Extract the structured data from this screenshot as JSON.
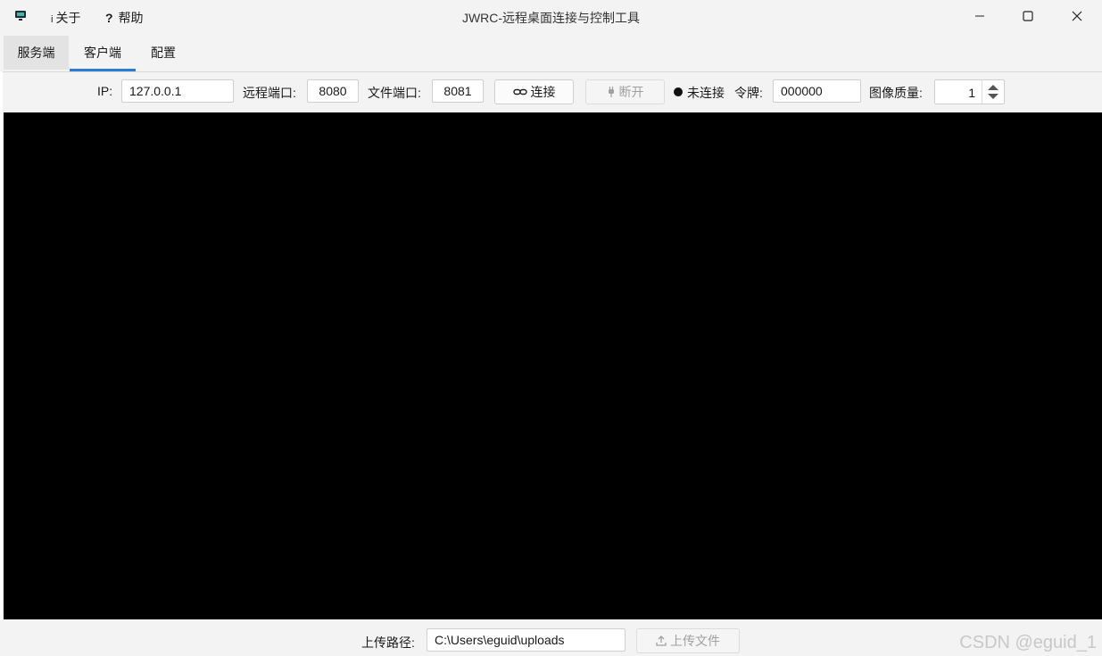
{
  "window": {
    "title": "JWRC-远程桌面连接与控制工具",
    "menu": [
      {
        "icon": "info-icon",
        "glyph": "i",
        "label": "关于"
      },
      {
        "icon": "help-icon",
        "glyph": "?",
        "label": "帮助"
      }
    ]
  },
  "tabs": [
    {
      "label": "服务端",
      "state": "hover"
    },
    {
      "label": "客户端",
      "state": "active"
    },
    {
      "label": "配置",
      "state": "normal"
    }
  ],
  "toolbar": {
    "ip_label": "IP:",
    "ip_value": "127.0.0.1",
    "remote_port_label": "远程端口:",
    "remote_port_value": "8080",
    "file_port_label": "文件端口:",
    "file_port_value": "8081",
    "connect_label": "连接",
    "disconnect_label": "断开",
    "status_text": "未连接",
    "token_label": "令牌:",
    "token_value": "000000",
    "quality_label": "图像质量:",
    "quality_value": "1"
  },
  "bottom": {
    "upload_path_label": "上传路径:",
    "upload_path_value": "C:\\Users\\eguid\\uploads",
    "upload_button_label": "上传文件"
  },
  "watermark": "CSDN @eguid_1",
  "colors": {
    "accent": "#2b7bd6",
    "viewer_bg": "#000000",
    "window_bg": "#f3f3f3"
  }
}
